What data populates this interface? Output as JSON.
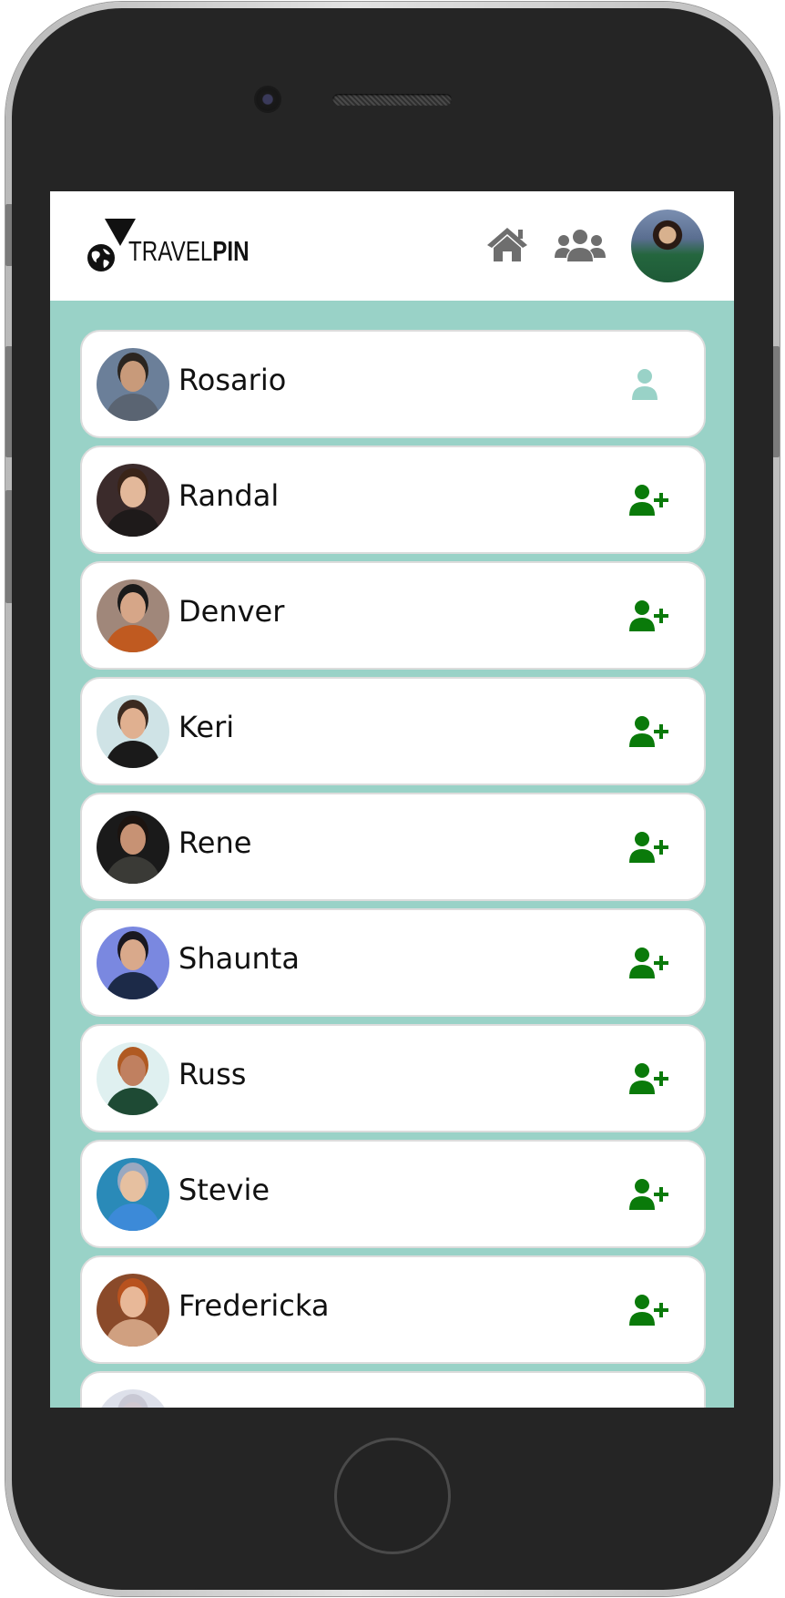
{
  "app": {
    "logo_text_light": "TRAVEL",
    "logo_text_bold": "PIN"
  },
  "header": {
    "icons": [
      "home-icon",
      "users-icon",
      "profile-avatar"
    ]
  },
  "colors": {
    "background": "#99d2c7",
    "added_icon": "#99d2c7",
    "add_icon": "#0a7a0a",
    "nav_icon": "#6e6e6e"
  },
  "people": [
    {
      "name": "Rosario",
      "status": "friend",
      "icon": "user-icon"
    },
    {
      "name": "Randal",
      "status": "add",
      "icon": "user-plus-icon"
    },
    {
      "name": "Denver",
      "status": "add",
      "icon": "user-plus-icon"
    },
    {
      "name": "Keri",
      "status": "add",
      "icon": "user-plus-icon"
    },
    {
      "name": "Rene",
      "status": "add",
      "icon": "user-plus-icon"
    },
    {
      "name": "Shaunta",
      "status": "add",
      "icon": "user-plus-icon"
    },
    {
      "name": "Russ",
      "status": "add",
      "icon": "user-plus-icon"
    },
    {
      "name": "Stevie",
      "status": "add",
      "icon": "user-plus-icon"
    },
    {
      "name": "Fredericka",
      "status": "add",
      "icon": "user-plus-icon"
    },
    {
      "name": "",
      "status": "add",
      "icon": "user-plus-icon"
    }
  ]
}
